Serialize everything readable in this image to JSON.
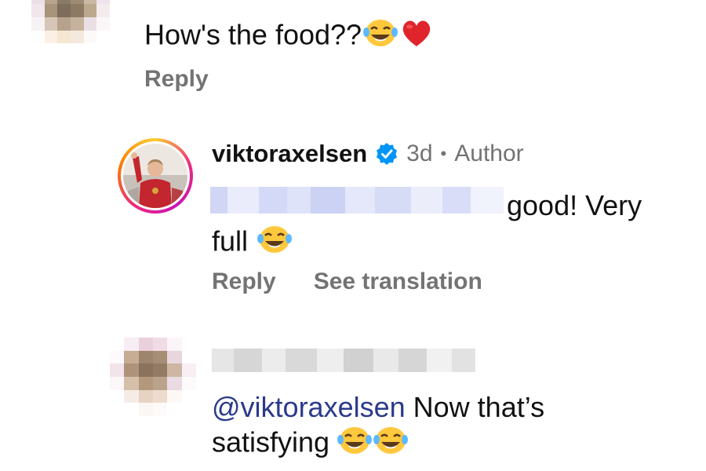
{
  "comment1": {
    "text": "How's the food??",
    "reply_label": "Reply"
  },
  "reply": {
    "username": "viktoraxelsen",
    "verified": true,
    "time": "3d",
    "separator": "•",
    "badge": "Author",
    "text_line1_visible": "good! Very",
    "text_line2": "full",
    "reply_label": "Reply",
    "translate_label": "See translation"
  },
  "comment2": {
    "mention": "@viktoraxelsen",
    "text_line1": "Now that’s",
    "text_line2": "satisfying",
    "emoji_count": 2
  },
  "colors": {
    "meta": "#737373",
    "mention": "#2a3a8c",
    "verified": "#0095f6",
    "heart": "#e0242b",
    "emoji_face": "#ffc83d"
  },
  "icons": [
    "laughing-crying-emoji",
    "red-heart-emoji",
    "verified-badge-icon",
    "pixelated-avatar",
    "profile-avatar-ring"
  ]
}
